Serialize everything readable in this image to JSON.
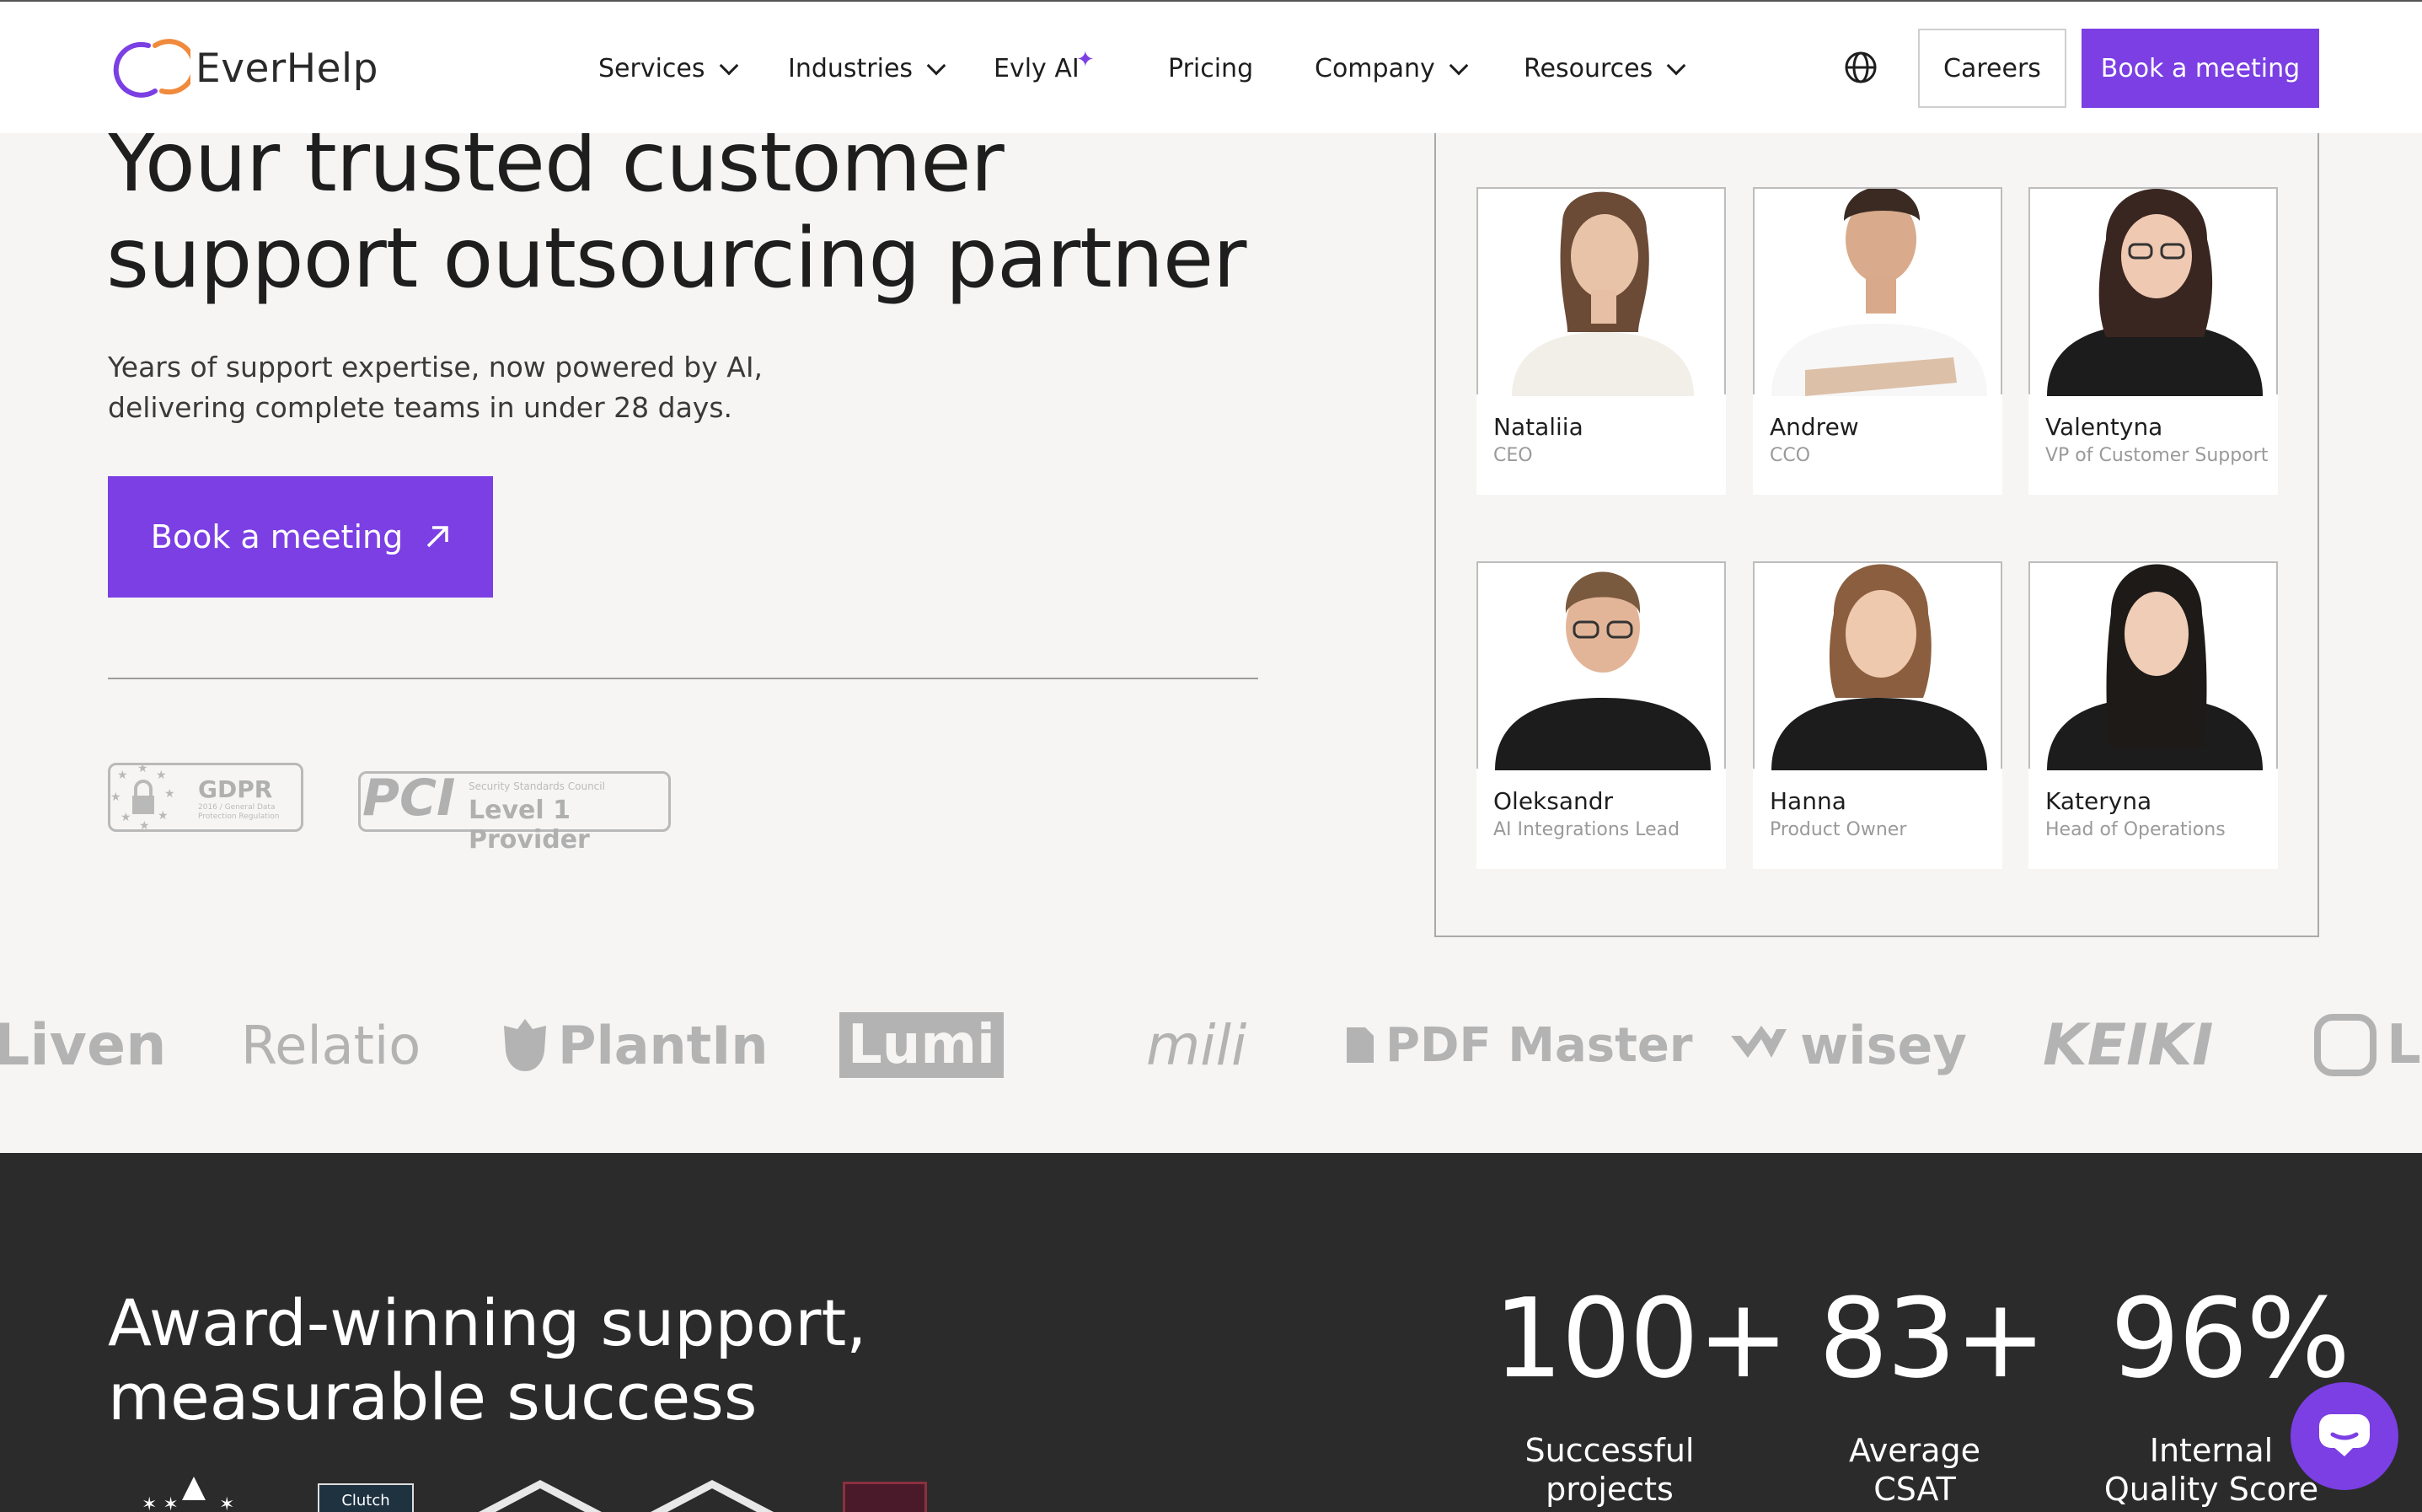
{
  "header": {
    "brand": "EverHelp",
    "nav": [
      {
        "label": "Services"
      },
      {
        "label": "Industries"
      },
      {
        "label": "Evly AI"
      },
      {
        "label": "Pricing"
      },
      {
        "label": "Company"
      },
      {
        "label": "Resources"
      }
    ],
    "careers_label": "Careers",
    "book_label": "Book a meeting"
  },
  "hero": {
    "title_line1": "Your trusted customer",
    "title_line2": "support outsourcing partner",
    "subtitle_line1": "Years of support expertise, now powered by AI,",
    "subtitle_line2": "delivering complete teams in under 28 days.",
    "cta_label": "Book a meeting",
    "badges": {
      "gdpr_title": "GDPR",
      "gdpr_sub": "2016 / General Data Protection Regulation",
      "pci_logo": "PCI",
      "pci_small": "Security Standards Council",
      "pci_title": "Level 1 Provider"
    }
  },
  "team": [
    {
      "name": "Nataliia",
      "role": "CEO"
    },
    {
      "name": "Andrew",
      "role": "CCO"
    },
    {
      "name": "Valentyna",
      "role": "VP of Customer Support"
    },
    {
      "name": "Oleksandr",
      "role": "AI Integrations Lead"
    },
    {
      "name": "Hanna",
      "role": "Product Owner"
    },
    {
      "name": "Kateryna",
      "role": "Head of Operations"
    }
  ],
  "clients": [
    "Liven",
    "Relatio",
    "PlantIn",
    "Lumi",
    "mili",
    "PDF Master",
    "wisey",
    "KEIKI",
    "Li"
  ],
  "awards": {
    "title_line1": "Award-winning support,",
    "title_line2": "measurable success",
    "badge_clutch": "Clutch"
  },
  "stats": [
    {
      "value": "100+",
      "label_line1": "Successful",
      "label_line2": "projects"
    },
    {
      "value": "83+",
      "label_line1": "Average",
      "label_line2": "CSAT"
    },
    {
      "value": "96%",
      "label_line1": "Internal",
      "label_line2": "Quality Score"
    }
  ],
  "colors": {
    "accent": "#7b3fe4",
    "dark": "#2b2b2b",
    "bg": "#f6f5f4"
  }
}
